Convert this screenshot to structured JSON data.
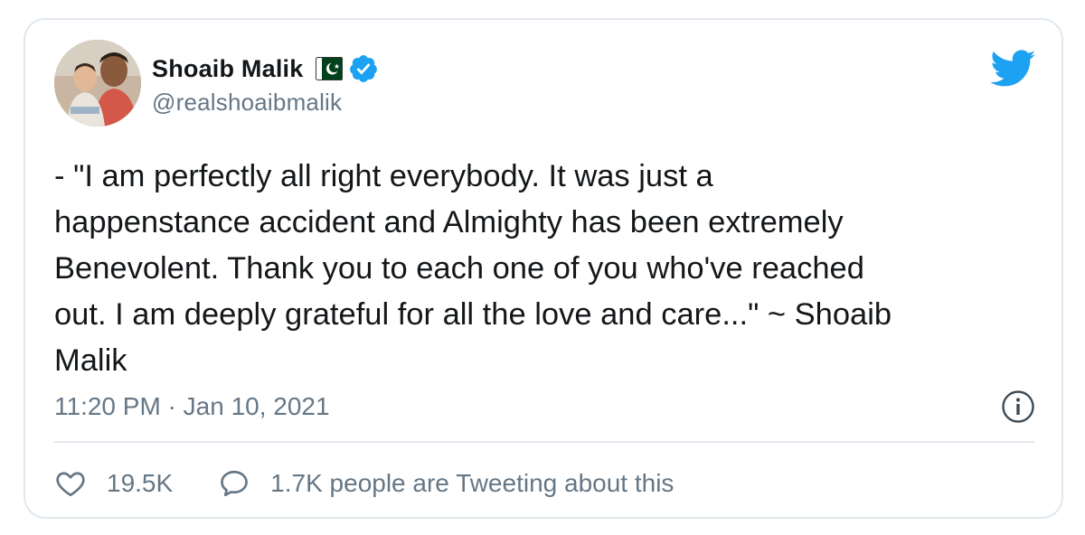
{
  "tweet": {
    "author": {
      "display_name": "Shoaib Malik",
      "handle": "@realshoaibmalik",
      "verified": true,
      "flag_icon": "pakistan-flag-icon"
    },
    "text": "- \"I am perfectly all right everybody. It was just a\nhappenstance accident and Almighty has been extremely\nBenevolent. Thank you to each one of you who've reached\nout. I am deeply grateful for all the love and care...\" ~ Shoaib\nMalik",
    "timestamp": "11:20 PM · Jan 10, 2021",
    "likes": "19.5K",
    "conversation": "1.7K people are Tweeting about this"
  },
  "icons": {
    "brand": "twitter-bird-icon",
    "info": "info-icon",
    "like": "heart-icon",
    "reply": "speech-bubble-icon",
    "verified": "verified-badge-icon"
  },
  "colors": {
    "brand": "#1da1f2",
    "text": "#14171a",
    "secondary_text": "#657786",
    "border": "#e1e8ed",
    "flag_green": "#01411c"
  }
}
